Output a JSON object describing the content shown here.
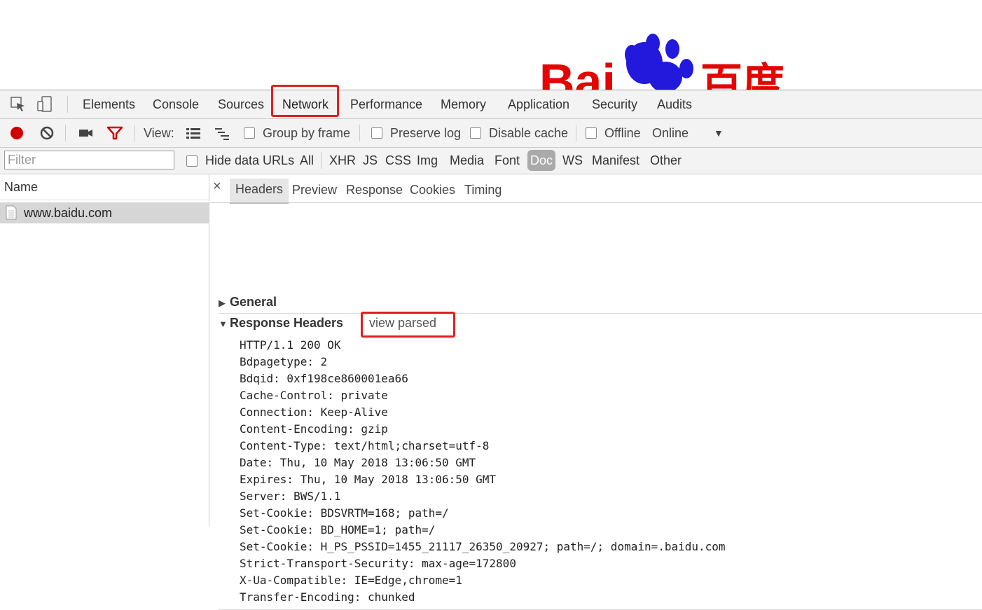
{
  "page": {
    "logo_text_left": "Bai",
    "logo_text_right": "百度"
  },
  "devtools": {
    "tabs": [
      "Elements",
      "Console",
      "Sources",
      "Network",
      "Performance",
      "Memory",
      "Application",
      "Security",
      "Audits"
    ],
    "selected_tab": "Network"
  },
  "toolbar": {
    "view_label": "View:",
    "group_by_frame": "Group by frame",
    "preserve_log": "Preserve log",
    "disable_cache": "Disable cache",
    "offline": "Offline",
    "throttle": "Online"
  },
  "filterbar": {
    "placeholder": "Filter",
    "hide_data_urls": "Hide data URLs",
    "types": [
      "All",
      "XHR",
      "JS",
      "CSS",
      "Img",
      "Media",
      "Font",
      "Doc",
      "WS",
      "Manifest",
      "Other"
    ],
    "active_type": "Doc"
  },
  "requests": {
    "header": "Name",
    "items": [
      {
        "name": "www.baidu.com"
      }
    ]
  },
  "detail": {
    "close": "×",
    "tabs": [
      "Headers",
      "Preview",
      "Response",
      "Cookies",
      "Timing"
    ],
    "selected_tab": "Headers",
    "general": "General",
    "response_headers": "Response Headers",
    "view_parsed": "view parsed",
    "header_lines": [
      "HTTP/1.1 200 OK",
      "Bdpagetype: 2",
      "Bdqid: 0xf198ce860001ea66",
      "Cache-Control: private",
      "Connection: Keep-Alive",
      "Content-Encoding: gzip",
      "Content-Type: text/html;charset=utf-8",
      "Date: Thu, 10 May 2018 13:06:50 GMT",
      "Expires: Thu, 10 May 2018 13:06:50 GMT",
      "Server: BWS/1.1",
      "Set-Cookie: BDSVRTM=168; path=/",
      "Set-Cookie: BD_HOME=1; path=/",
      "Set-Cookie: H_PS_PSSID=1455_21117_26350_20927; path=/; domain=.baidu.com",
      "Strict-Transport-Security: max-age=172800",
      "X-Ua-Compatible: IE=Edge,chrome=1",
      "Transfer-Encoding: chunked"
    ]
  },
  "colors": {
    "highlight_box": "#e02020",
    "record": "#d10000",
    "filter_icon": "#d10000",
    "baidu_red": "#e10601",
    "baidu_blue": "#2319dc"
  }
}
